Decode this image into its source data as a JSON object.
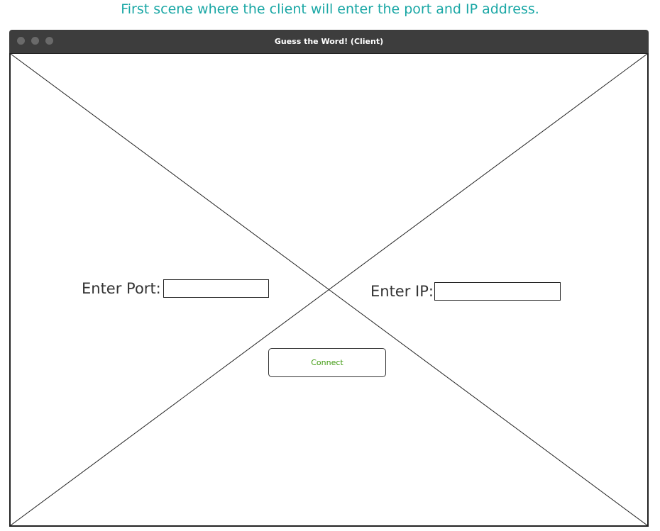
{
  "caption": "First scene where the client will enter the port and IP address.",
  "window": {
    "title": "Guess the Word! (Client)",
    "controls": [
      "close-dot",
      "minimize-dot",
      "maximize-dot"
    ]
  },
  "form": {
    "port_label": "Enter Port:",
    "port_value": "",
    "ip_label": "Enter IP:",
    "ip_value": "",
    "connect_label": "Connect"
  },
  "colors": {
    "caption": "#1aa7a5",
    "titlebar": "#3d3d3d",
    "connect_text": "#3f9a0f"
  }
}
